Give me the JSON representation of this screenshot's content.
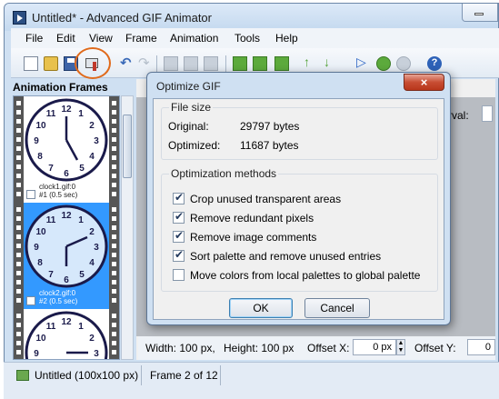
{
  "window": {
    "title": "Untitled* - Advanced GIF Animator"
  },
  "menu": [
    "File",
    "Edit",
    "View",
    "Frame",
    "Animation",
    "Tools",
    "Help"
  ],
  "toolbar": {
    "icons": [
      "new-icon",
      "open-icon",
      "save-icon",
      "optimize-icon",
      "undo-icon",
      "redo-icon"
    ]
  },
  "frames_panel": {
    "title": "Animation Frames",
    "frames": [
      {
        "file": "clock1.gif:0",
        "info": "#1 (0.5 sec)",
        "selected": false
      },
      {
        "file": "clock2.gif:0",
        "info": "#2 (0.5 sec)",
        "selected": true
      },
      {
        "file": "",
        "info": "",
        "selected": false
      }
    ]
  },
  "right": {
    "interval_label": "rval:"
  },
  "props": {
    "width_text": "Width: 100 px,",
    "height_text": "Height: 100 px",
    "offset_x_label": "Offset X:",
    "offset_x_value": "0 px",
    "offset_y_label": "Offset Y:",
    "offset_y_value": "0"
  },
  "status": {
    "image_info": "Untitled (100x100 px)",
    "frame_info": "Frame 2 of 12"
  },
  "dialog": {
    "title": "Optimize GIF",
    "close": "×",
    "file_size_title": "File size",
    "original_label": "Original:",
    "original_value": "29797 bytes",
    "optimized_label": "Optimized:",
    "optimized_value": "11687 bytes",
    "methods_title": "Optimization methods",
    "options": [
      {
        "label": "Crop unused transparent areas",
        "checked": true
      },
      {
        "label": "Remove redundant pixels",
        "checked": true
      },
      {
        "label": "Remove image comments",
        "checked": true
      },
      {
        "label": "Sort palette and remove unused entries",
        "checked": true
      },
      {
        "label": "Move colors from local palettes to global palette",
        "checked": false
      }
    ],
    "ok_label": "OK",
    "cancel_label": "Cancel"
  }
}
